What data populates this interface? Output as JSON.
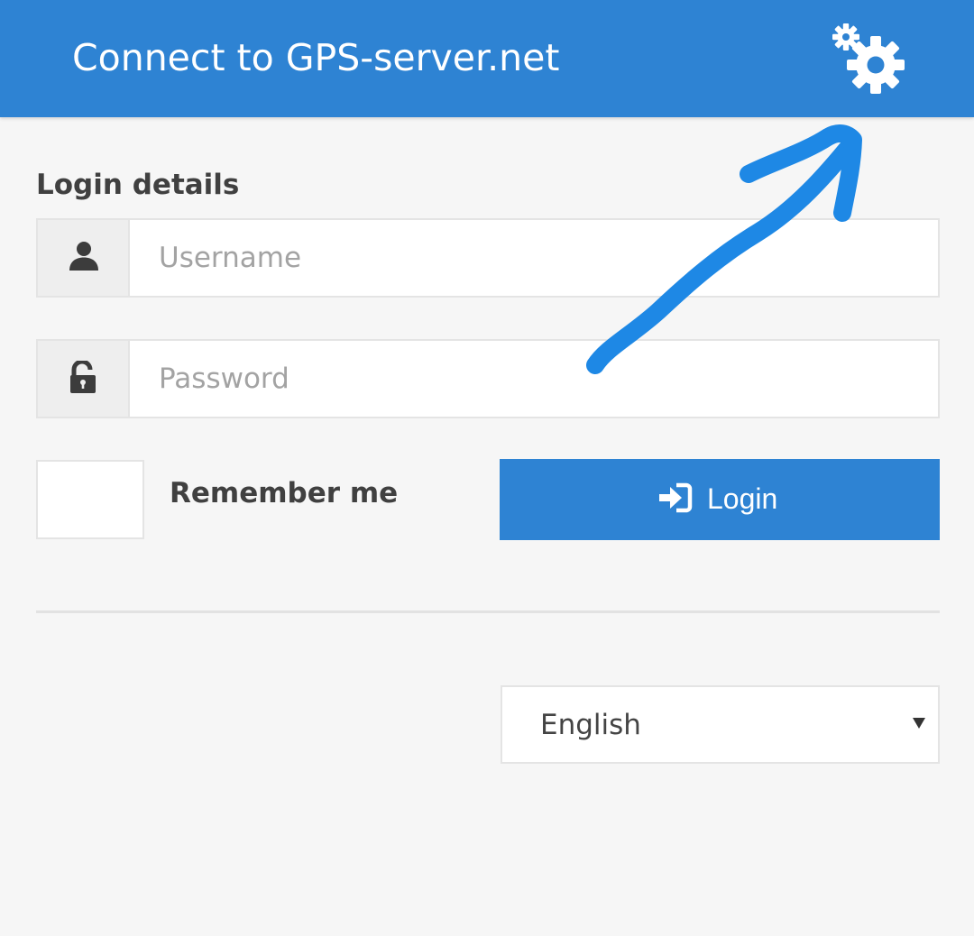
{
  "header": {
    "title": "Connect to GPS-server.net",
    "settings_icon": "gears-icon",
    "background": "#2e83d3"
  },
  "login": {
    "section_title": "Login details",
    "username": {
      "icon": "user-icon",
      "placeholder": "Username",
      "value": ""
    },
    "password": {
      "icon": "lock-icon",
      "placeholder": "Password",
      "value": ""
    },
    "remember_label": "Remember me",
    "remember_checked": false,
    "button": {
      "icon": "sign-in-icon",
      "label": "Login",
      "color": "#2e83d3"
    }
  },
  "language": {
    "selected": "English",
    "caret_icon": "caret-down-icon"
  },
  "annotation": {
    "type": "hand-drawn-arrow",
    "color": "#1e88e5",
    "points_to": "settings-button"
  }
}
